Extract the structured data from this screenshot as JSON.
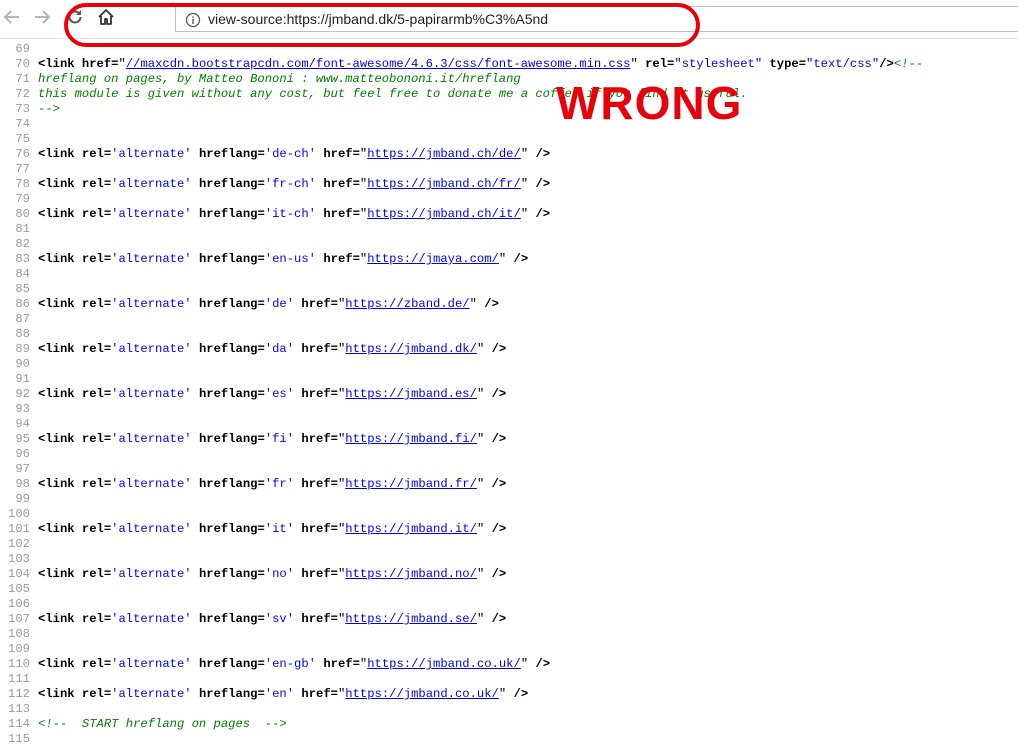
{
  "browser": {
    "url": "view-source:https://jmband.dk/5-papirarmb%C3%A5nd"
  },
  "annotation": {
    "label": "WRONG"
  },
  "css_link": {
    "line_no": "70",
    "tag": "<link",
    "href_attr": "href=",
    "href_url": "//maxcdn.bootstrapcdn.com/font-awesome/4.6.3/css/font-awesome.min.css",
    "rel_attr": "rel=",
    "rel_val": "\"stylesheet\"",
    "type_attr": "type=",
    "type_val": "\"text/css\"",
    "close": "/>",
    "comment_start": "<!--"
  },
  "comment_lines": [
    {
      "line_no": "71",
      "text": "hreflang on pages, by Matteo Bononi : www.matteobononi.it/hreflang"
    },
    {
      "line_no": "72",
      "text": "this module is given without any cost, but feel free to donate me a coffee if you find it useful."
    },
    {
      "line_no": "73",
      "text": "-->"
    }
  ],
  "link_tag": "<link",
  "rel_attr": "rel=",
  "rel_val": "'alternate'",
  "hreflang_attr": "hreflang=",
  "href_attr": "href=",
  "tag_close": "/>",
  "hreflang_links": [
    {
      "line_no": "76",
      "lang": "'de-ch'",
      "url": "https://jmband.ch/de/"
    },
    {
      "line_no": "78",
      "lang": "'fr-ch'",
      "url": "https://jmband.ch/fr/"
    },
    {
      "line_no": "80",
      "lang": "'it-ch'",
      "url": "https://jmband.ch/it/"
    },
    {
      "line_no": "83",
      "lang": "'en-us'",
      "url": "https://jmaya.com/"
    },
    {
      "line_no": "86",
      "lang": "'de'",
      "url": "https://zband.de/"
    },
    {
      "line_no": "89",
      "lang": "'da'",
      "url": "https://jmband.dk/"
    },
    {
      "line_no": "92",
      "lang": "'es'",
      "url": "https://jmband.es/"
    },
    {
      "line_no": "95",
      "lang": "'fi'",
      "url": "https://jmband.fi/"
    },
    {
      "line_no": "98",
      "lang": "'fr'",
      "url": "https://jmband.fr/"
    },
    {
      "line_no": "101",
      "lang": "'it'",
      "url": "https://jmband.it/"
    },
    {
      "line_no": "104",
      "lang": "'no'",
      "url": "https://jmband.no/"
    },
    {
      "line_no": "107",
      "lang": "'sv'",
      "url": "https://jmband.se/"
    },
    {
      "line_no": "110",
      "lang": "'en-gb'",
      "url": "https://jmband.co.uk/"
    },
    {
      "line_no": "112",
      "lang": "'en'",
      "url": "https://jmband.co.uk/"
    }
  ],
  "empty_lines": [
    "69",
    "74",
    "75",
    "77",
    "79",
    "81",
    "82",
    "84",
    "85",
    "87",
    "88",
    "90",
    "91",
    "93",
    "94",
    "96",
    "97",
    "99",
    "100",
    "102",
    "103",
    "105",
    "106",
    "108",
    "109",
    "111",
    "113",
    "115"
  ],
  "final_comment": {
    "line_no": "114",
    "text": "<!--  START hreflang on pages  -->"
  },
  "colors": {
    "annotation_red": "#e8000b",
    "tag": "#880088",
    "attr_value": "#0000ff",
    "link": "#0000ee",
    "comment": "#008000",
    "line_number": "#9a9a9a"
  },
  "icons": {
    "back": "arrow-left-icon",
    "forward": "arrow-right-icon",
    "reload": "reload-icon",
    "home": "home-icon",
    "info": "info-circle-icon"
  }
}
